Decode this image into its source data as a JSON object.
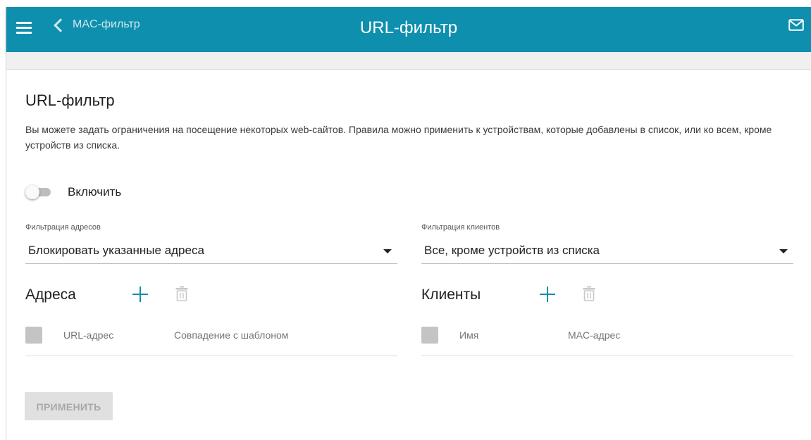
{
  "header": {
    "title": "URL-фильтр",
    "back_label": "MAC-фильтр"
  },
  "page": {
    "heading": "URL-фильтр",
    "description": "Вы можете задать ограничения на посещение некоторых web-сайтов. Правила можно применить к устройствам, которые добавлены в список, или ко всем, кроме устройств из списка."
  },
  "enable": {
    "label": "Включить",
    "state": "off"
  },
  "address_filter": {
    "label": "Фильтрация адресов",
    "value": "Блокировать указанные адреса"
  },
  "client_filter": {
    "label": "Фильтрация клиентов",
    "value": "Все, кроме устройств из списка"
  },
  "addresses": {
    "title": "Адреса",
    "columns": [
      "URL-адрес",
      "Совпадение с шаблоном"
    ]
  },
  "clients": {
    "title": "Клиенты",
    "columns": [
      "Имя",
      "MAC-адрес"
    ]
  },
  "apply_label": "ПРИМЕНИТЬ",
  "colors": {
    "accent": "#0f8fae",
    "disabled_button": "#e0e0e0"
  },
  "icons": [
    "menu-icon",
    "chevron-left-icon",
    "mail-icon",
    "plus-icon",
    "trash-icon"
  ]
}
